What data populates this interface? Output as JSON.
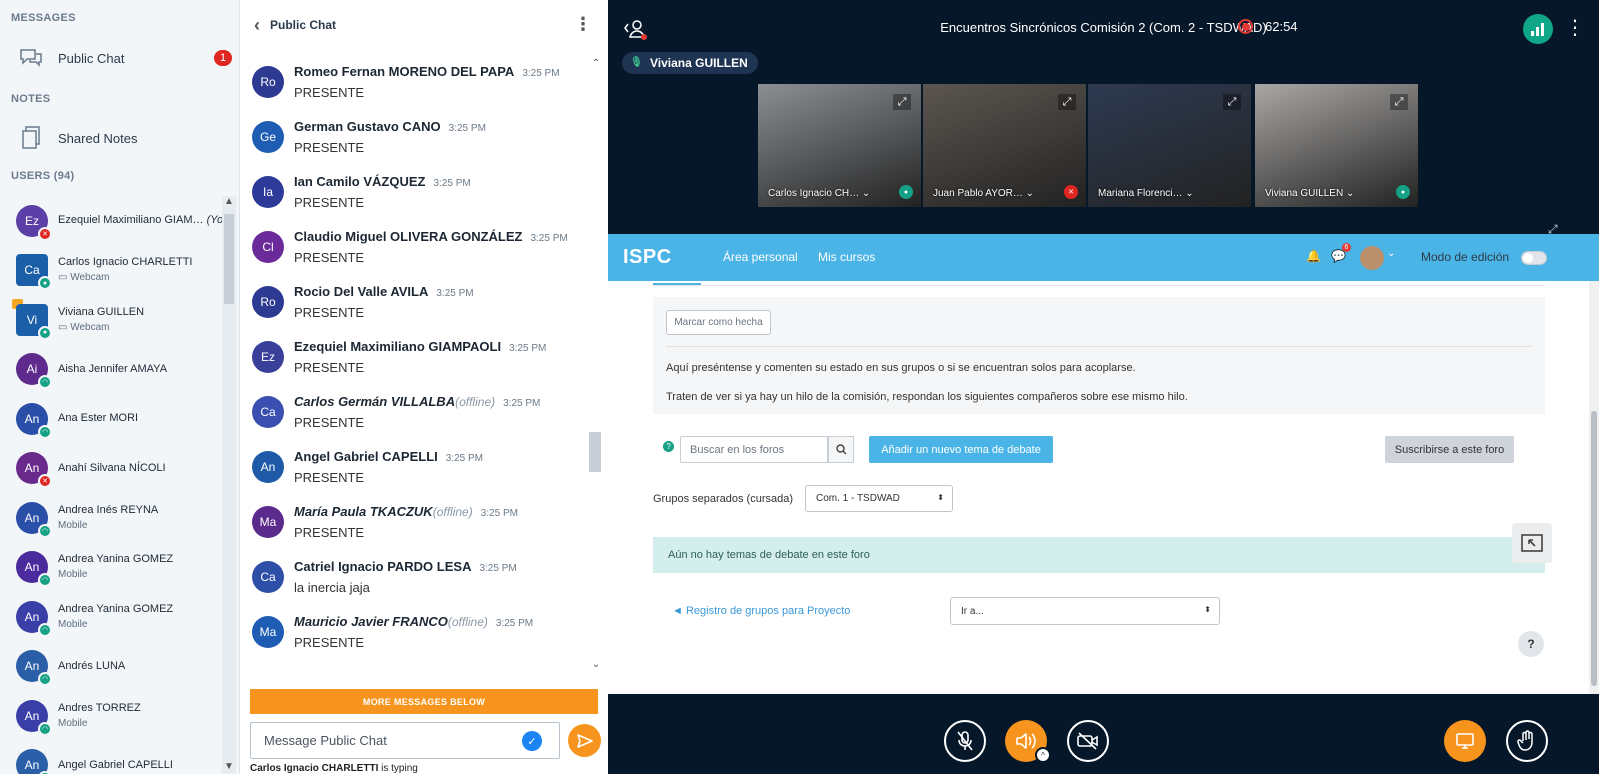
{
  "sidebar": {
    "messages_title": "MESSAGES",
    "public_chat_label": "Public Chat",
    "public_chat_unread": "1",
    "notes_title": "NOTES",
    "shared_notes_label": "Shared Notes",
    "users_title": "USERS (94)",
    "users": [
      {
        "initials": "Ez",
        "name": "Ezequiel Maximiliano GIAM…",
        "you": "(You)",
        "sub": "",
        "color": "#5b3fa6",
        "status": "muted"
      },
      {
        "initials": "Ca",
        "name": "Carlos Ignacio CHARLETTI",
        "you": "",
        "sub": "Webcam",
        "color": "#1a5fa8",
        "status": "mic",
        "square": true
      },
      {
        "initials": "Vi",
        "name": "Viviana GUILLEN",
        "you": "",
        "sub": "Webcam",
        "color": "#1a5fa8",
        "status": "mic",
        "square": true,
        "presenter": true
      },
      {
        "initials": "Ai",
        "name": "Aisha Jennifer AMAYA",
        "you": "",
        "sub": "",
        "color": "#5e2a8c",
        "status": "listen"
      },
      {
        "initials": "An",
        "name": "Ana Ester MORI",
        "you": "",
        "sub": "",
        "color": "#2a4fa8",
        "status": "listen"
      },
      {
        "initials": "An",
        "name": "Anahí Silvana NÍCOLI",
        "you": "",
        "sub": "",
        "color": "#6a2a8c",
        "status": "muted"
      },
      {
        "initials": "An",
        "name": "Andrea Inés REYNA",
        "you": "",
        "sub": "Mobile",
        "color": "#2a4fa8",
        "status": "listen"
      },
      {
        "initials": "An",
        "name": "Andrea Yanina GOMEZ",
        "you": "",
        "sub": "Mobile",
        "color": "#4a2a9c",
        "status": "listen"
      },
      {
        "initials": "An",
        "name": "Andrea Yanina GOMEZ",
        "you": "",
        "sub": "Mobile",
        "color": "#3a3fa8",
        "status": "listen"
      },
      {
        "initials": "An",
        "name": "Andrés LUNA",
        "you": "",
        "sub": "",
        "color": "#2a5fa8",
        "status": "listen"
      },
      {
        "initials": "An",
        "name": "Andres TORREZ",
        "you": "",
        "sub": "Mobile",
        "color": "#3a3fa8",
        "status": "listen"
      },
      {
        "initials": "An",
        "name": "Angel Gabriel CAPELLI",
        "you": "",
        "sub": "",
        "color": "#2a5fa8",
        "status": "listen"
      }
    ]
  },
  "chat": {
    "title": "Public Chat",
    "messages": [
      {
        "initials": "Ro",
        "name": "Romeo Fernan MORENO DEL PAPA",
        "offline": "",
        "time": "3:25 PM",
        "text": "PRESENTE",
        "color": "#2c3a91"
      },
      {
        "initials": "Ge",
        "name": "German Gustavo CANO",
        "offline": "",
        "time": "3:25 PM",
        "text": "PRESENTE",
        "color": "#1e5db3"
      },
      {
        "initials": "Ia",
        "name": "Ian Camilo VÁZQUEZ",
        "offline": "",
        "time": "3:25 PM",
        "text": "PRESENTE",
        "color": "#2d3a9a"
      },
      {
        "initials": "Cl",
        "name": "Claudio Miguel OLIVERA GONZÁLEZ",
        "offline": "",
        "time": "3:25 PM",
        "text": "PRESENTE",
        "color": "#6a2a9a"
      },
      {
        "initials": "Ro",
        "name": "Rocio Del Valle AVILA",
        "offline": "",
        "time": "3:25 PM",
        "text": "PRESENTE",
        "color": "#2c3a91"
      },
      {
        "initials": "Ez",
        "name": "Ezequiel Maximiliano GIAMPAOLI",
        "offline": "",
        "time": "3:25 PM",
        "text": "PRESENTE",
        "color": "#3a3f9a"
      },
      {
        "initials": "Ca",
        "name": "Carlos Germán VILLALBA",
        "offline": "(offline)",
        "time": "3:25 PM",
        "text": "PRESENTE",
        "color": "#3a4fb0"
      },
      {
        "initials": "An",
        "name": "Angel Gabriel CAPELLI",
        "offline": "",
        "time": "3:25 PM",
        "text": "PRESENTE",
        "color": "#1e5aa8"
      },
      {
        "initials": "Ma",
        "name": "María Paula TKACZUK",
        "offline": "(offline)",
        "time": "3:25 PM",
        "text": "PRESENTE",
        "color": "#5a2a8c"
      },
      {
        "initials": "Ca",
        "name": "Catriel Ignacio PARDO LESA",
        "offline": "",
        "time": "3:25 PM",
        "text": "la inercia jaja",
        "color": "#2d4fa8"
      },
      {
        "initials": "Ma",
        "name": "Mauricio Javier FRANCO",
        "offline": "(offline)",
        "time": "3:25 PM",
        "text": "PRESENTE",
        "color": "#1e5db3"
      }
    ],
    "more_messages_label": "MORE MESSAGES BELOW",
    "input_placeholder": "Message Public Chat",
    "typing_user": "Carlos Ignacio CHARLETTI",
    "typing_suffix": " is typing"
  },
  "meeting": {
    "title": "Encuentros Sincrónicos Comisión 2 (Com. 2 - TSDWAD)",
    "recording_time": "62:54",
    "talker": "Viviana GUILLEN",
    "videos": [
      {
        "name": "Carlos Ignacio CH…",
        "bg": "#8b8f93",
        "status": "mic"
      },
      {
        "name": "Juan Pablo AYOR…",
        "bg": "#5c5650",
        "status": "muted"
      },
      {
        "name": "Mariana Florenci…",
        "bg": "#2e3a52",
        "status": ""
      },
      {
        "name": "Viviana GUILLEN",
        "bg": "#a9a7a5",
        "status": "mic",
        "speaking": true
      }
    ]
  },
  "presentation": {
    "logo": "ISPC",
    "nav_links": [
      "Área personal",
      "Mis cursos"
    ],
    "messages_count": "6",
    "edit_mode_label": "Modo de edición",
    "mark_done_label": "Marcar como hecha",
    "intro_line1": "Aquí preséntense y comenten su estado en sus grupos o si se encuentran solos para acoplarse.",
    "intro_line2": "Traten de ver si ya hay un hilo de la comisión, respondan los siguientes compañeros  sobre ese mismo hilo.",
    "search_placeholder": "Buscar en los foros",
    "new_topic_label": "Añadir un nuevo tema de debate",
    "subscribe_label": "Suscribirse a este foro",
    "groups_label": "Grupos separados (cursada)",
    "groups_value": "Com. 1 - TSDWAD",
    "no_topics_text": "Aún no hay temas de debate en este foro",
    "registry_link": "◄ Registro de grupos para Proyecto",
    "goto_value": "Ir a...",
    "help_label": "?"
  }
}
